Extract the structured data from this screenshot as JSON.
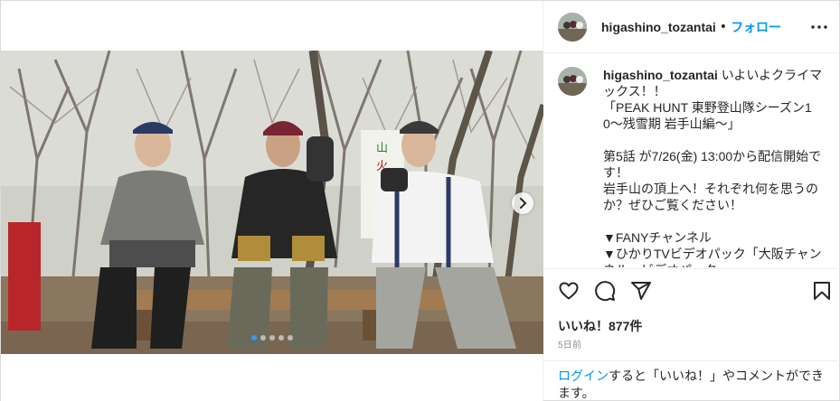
{
  "post": {
    "username": "higashino_tozantai",
    "separator": "•",
    "follow_label": "フォロー",
    "caption": "いよいよクライマックス！！\n「PEAK HUNT 東野登山隊シーズン10〜残雪期 岩手山編〜」\n\n第5話 が7/26(金) 13:00から配信開始です！\n岩手山の頂上へ！それぞれ何を思うのか？ぜひご覧ください！\n\n▼FANYチャンネル\n▼ひかりTVビデオパック「大阪チャンネル」ビデオパック",
    "likes": "いいね！877件",
    "time_ago": "5日前",
    "login_link": "ログイン",
    "login_text": "すると「いいね！」やコメントができます。",
    "photo_sign_text": "山火",
    "carousel_dot_count": 5,
    "carousel_active_index": 0
  },
  "icons": {
    "more": "more-horizontal-icon",
    "next": "chevron-right-icon",
    "like": "heart-icon",
    "comment": "comment-icon",
    "share": "share-icon",
    "save": "bookmark-icon"
  },
  "colors": {
    "link": "#0095f6",
    "text": "#262626",
    "muted": "#8e8e8e",
    "active_dot": "#3897f0"
  }
}
